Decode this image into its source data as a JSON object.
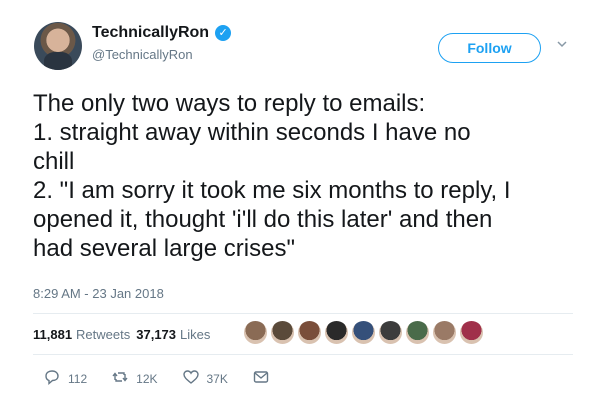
{
  "author": {
    "display_name": "TechnicallyRon",
    "handle": "@TechnicallyRon",
    "verified_glyph": "✓"
  },
  "follow_label": "Follow",
  "tweet": {
    "lines": [
      "The only two ways to reply to emails:",
      "1. straight away within seconds I have no",
      "chill",
      "2. \"I am sorry it took me six months to reply, I",
      "opened it, thought 'i'll do this later' and then",
      "had several large crises\""
    ],
    "timestamp": "8:29 AM - 23 Jan 2018"
  },
  "stats": {
    "retweets_count": "11,881",
    "retweets_label": "Retweets",
    "likes_count": "37,173",
    "likes_label": "Likes"
  },
  "liker_avatars": [
    "#8a6b55",
    "#5a4a3a",
    "#7a4e3a",
    "#2a2a2a",
    "#35507a",
    "#3c3c3c",
    "#4a6b4a",
    "#9a7a66",
    "#a0304a"
  ],
  "actions": {
    "reply_count": "112",
    "retweet_count": "12K",
    "like_count": "37K"
  },
  "icons": {
    "reply": "reply-icon",
    "retweet": "retweet-icon",
    "like": "heart-icon",
    "message": "envelope-icon",
    "caret": "chevron-down-icon",
    "verified": "verified-badge-icon"
  },
  "colors": {
    "accent": "#1da1f2",
    "secondary_text": "#657786",
    "primary_text": "#14171a"
  }
}
